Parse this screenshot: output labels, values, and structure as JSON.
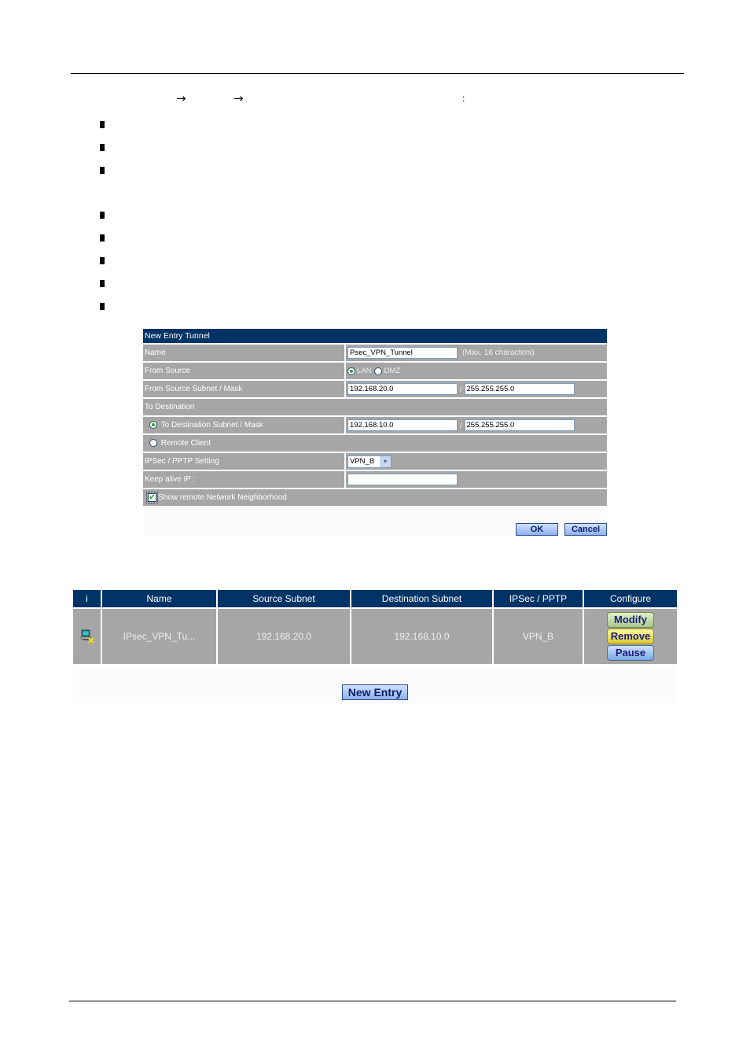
{
  "page": {
    "nav_arrows": [
      "→",
      "→"
    ],
    "nav_colon": ":",
    "bullet_count": 8
  },
  "form": {
    "title": "New Entry Tunnel",
    "name": {
      "label": "Name",
      "value": "Psec_VPN_Tunnel",
      "hint": "(Max. 16 characters)"
    },
    "from_source": {
      "label": "From Source",
      "options": [
        "LAN",
        "DMZ"
      ],
      "selected": "LAN"
    },
    "source_subnet": {
      "label": "From Source Subnet / Mask",
      "subnet": "192.168.20.0",
      "separator": "/",
      "mask": "255.255.255.0"
    },
    "to_destination": {
      "label": "To Destination"
    },
    "dest_subnet": {
      "label": "To Destination Subnet / Mask",
      "selected": true,
      "subnet": "192.168.10.0",
      "separator": "/",
      "mask": "255.255.255.0"
    },
    "remote_client": {
      "label": "Remote Client",
      "selected": false
    },
    "ipsec_pptp": {
      "label": "IPSec / PPTP Setting",
      "value": "VPN_B",
      "arrow": "▾"
    },
    "keep_alive": {
      "label": "Keep alive IP :",
      "value": ""
    },
    "show_neighborhood": {
      "label": "Show remote Network Neighborhood",
      "checked": true,
      "check": "✔"
    },
    "ok_label": "OK",
    "cancel_label": "Cancel"
  },
  "table": {
    "headers": [
      "i",
      "Name",
      "Source Subnet",
      "Destination Subnet",
      "IPSec / PPTP",
      "Configure"
    ],
    "rows": [
      {
        "icon": "network-computer-disconnected-icon",
        "name": "IPsec_VPN_Tu...",
        "source_subnet": "192.168.20.0",
        "destination_subnet": "192.168.10.0",
        "ipsec_pptp": "VPN_B",
        "actions": [
          "Modify",
          "Remove",
          "Pause"
        ]
      }
    ],
    "new_entry_label": "New Entry"
  }
}
